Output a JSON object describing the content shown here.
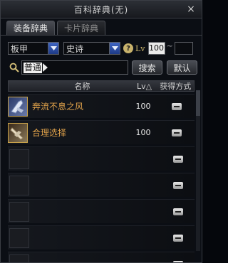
{
  "window": {
    "title": "百科辞典(无)",
    "close_glyph": "×"
  },
  "tabs": [
    {
      "label": "装备辞典",
      "active": true
    },
    {
      "label": "卡片辞典",
      "active": false
    }
  ],
  "filters": {
    "category": "板甲",
    "rarity": "史诗",
    "help_glyph": "?",
    "lv_label": "Lv",
    "lv_min": "100",
    "tilde": "~",
    "lv_max": ""
  },
  "search": {
    "value": "普通",
    "search_button": "搜索",
    "default_button": "默认"
  },
  "table": {
    "headers": {
      "name": "名称",
      "lv": "Lv△",
      "source": "获得方式"
    },
    "rows": [
      {
        "name": "奔流不息之风",
        "lv": "100",
        "has_item": true
      },
      {
        "name": "合理选择",
        "lv": "100",
        "has_item": true
      },
      {
        "name": "",
        "lv": "",
        "has_item": false
      },
      {
        "name": "",
        "lv": "",
        "has_item": false
      },
      {
        "name": "",
        "lv": "",
        "has_item": false
      },
      {
        "name": "",
        "lv": "",
        "has_item": false
      },
      {
        "name": "",
        "lv": "",
        "has_item": false
      }
    ]
  },
  "colors": {
    "accent": "#c9b36c",
    "item_name": "#e0a24a",
    "arrow_blue": "#2f54b0"
  }
}
